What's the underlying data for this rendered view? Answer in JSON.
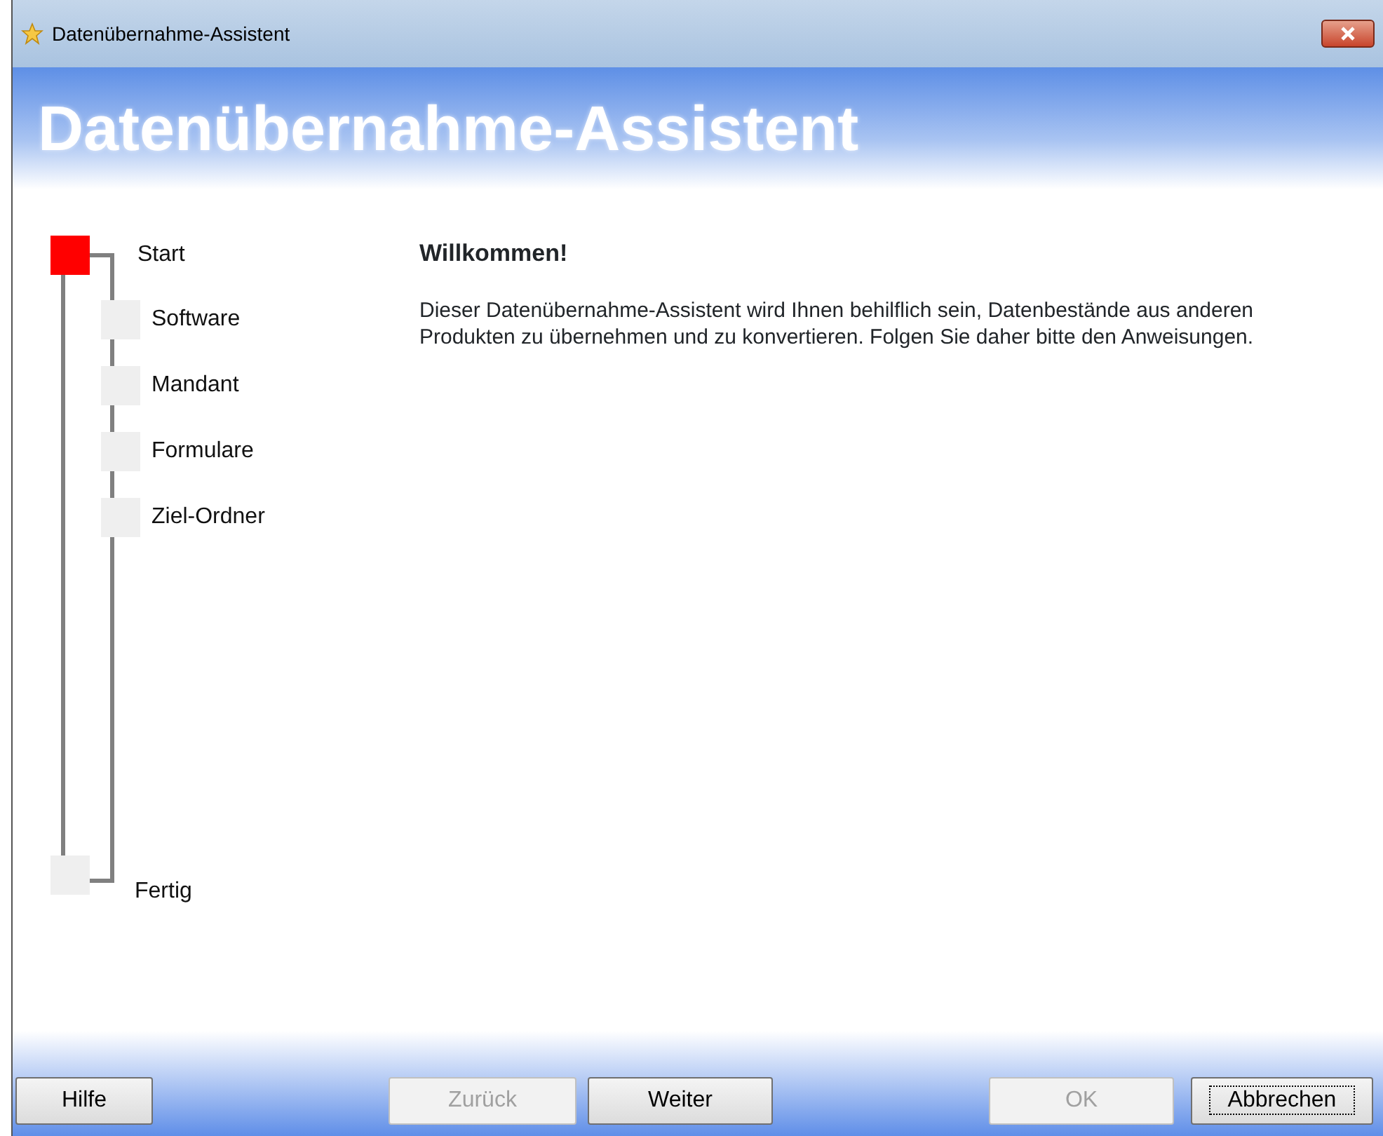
{
  "window": {
    "title": "Datenübernahme-Assistent"
  },
  "header": {
    "title": "Datenübernahme-Assistent"
  },
  "steps": [
    {
      "label": "Start",
      "kind": "main",
      "selected": true
    },
    {
      "label": "Software",
      "kind": "sub",
      "selected": false
    },
    {
      "label": "Mandant",
      "kind": "sub",
      "selected": false
    },
    {
      "label": "Formulare",
      "kind": "sub",
      "selected": false
    },
    {
      "label": "Ziel-Ordner",
      "kind": "sub",
      "selected": false
    },
    {
      "label": "Fertig",
      "kind": "main",
      "selected": false
    }
  ],
  "content": {
    "heading": "Willkommen!",
    "text": "Dieser Datenübernahme-Assistent wird Ihnen behilflich sein, Datenbestände aus anderen Produkten zu übernehmen und zu konvertieren. Folgen Sie daher bitte den Anweisungen."
  },
  "buttons": {
    "left": [
      {
        "label": "Hilfe",
        "disabled": false,
        "focused": false
      }
    ],
    "middle": [
      {
        "label": "Zurück",
        "disabled": true,
        "focused": false
      },
      {
        "label": "Weiter",
        "disabled": false,
        "focused": false
      }
    ],
    "right": [
      {
        "label": "OK",
        "disabled": true,
        "focused": false
      },
      {
        "label": "Abbrechen",
        "disabled": false,
        "focused": true
      }
    ]
  }
}
